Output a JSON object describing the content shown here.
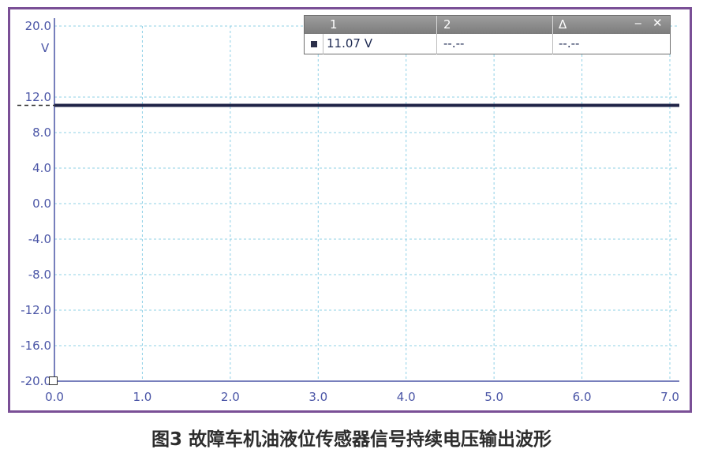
{
  "chart_data": {
    "type": "line",
    "unit_label": "V",
    "x_ticks": [
      "0.0",
      "1.0",
      "2.0",
      "3.0",
      "4.0",
      "5.0",
      "6.0",
      "7.0"
    ],
    "y_ticks": [
      "20.0",
      "12.0",
      "8.0",
      "4.0",
      "0.0",
      "-4.0",
      "-8.0",
      "-12.0",
      "-16.0",
      "-20.0"
    ],
    "xlim": [
      0,
      7
    ],
    "ylim": [
      -20,
      20
    ],
    "grid": true,
    "reference_level": 11.07,
    "series": [
      {
        "x": [
          0,
          7
        ],
        "y": [
          11.07,
          11.07
        ],
        "color": "#1f2347"
      }
    ]
  },
  "cursor_panel": {
    "headers": [
      "1",
      "2",
      "Δ"
    ],
    "values": [
      "11.07 V",
      "--.--",
      "--.--"
    ],
    "minimize_glyph": "‒",
    "close_glyph": "✕"
  },
  "caption": "图3 故障车机油液位传感器信号持续电压输出波形"
}
